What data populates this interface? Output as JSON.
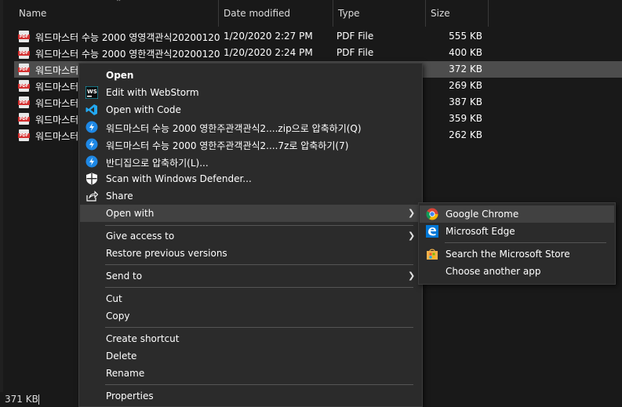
{
  "columns": {
    "name": "Name",
    "date": "Date modified",
    "type": "Type",
    "size": "Size"
  },
  "files": [
    {
      "name": "워드마스터 수능 2000 영영객관식20200120",
      "date": "1/20/2020 2:27 PM",
      "type": "PDF File",
      "size": "555 KB"
    },
    {
      "name": "워드마스터 수능 2000 영한객관식20200120",
      "date": "1/20/2020 2:24 PM",
      "type": "PDF File",
      "size": "400 KB"
    },
    {
      "name": "워드마스터",
      "date": "",
      "type": "",
      "size": "372 KB"
    },
    {
      "name": "워드마스터",
      "date": "",
      "type": "",
      "size": "269 KB"
    },
    {
      "name": "워드마스터",
      "date": "",
      "type": "",
      "size": "387 KB"
    },
    {
      "name": "워드마스터",
      "date": "",
      "type": "",
      "size": "359 KB"
    },
    {
      "name": "워드마스터",
      "date": "",
      "type": "",
      "size": "262 KB"
    }
  ],
  "context_menu": {
    "open": "Open",
    "edit_webstorm": "Edit with WebStorm",
    "open_code": "Open with Code",
    "zip": "워드마스터 수능 2000 영한주관객관식2....zip으로 압축하기(Q)",
    "sevenz": "워드마스터 수능 2000 영한주관객관식2....7z로 압축하기(7)",
    "bandizip": "반디집으로 압축하기(L)...",
    "defender": "Scan with Windows Defender...",
    "share": "Share",
    "open_with": "Open with",
    "give_access": "Give access to",
    "restore": "Restore previous versions",
    "send_to": "Send to",
    "cut": "Cut",
    "copy": "Copy",
    "create_shortcut": "Create shortcut",
    "delete": "Delete",
    "rename": "Rename",
    "properties": "Properties"
  },
  "submenu": {
    "chrome": "Google Chrome",
    "edge": "Microsoft Edge",
    "store": "Search the Microsoft Store",
    "another": "Choose another app"
  },
  "status": {
    "size": "371 KB"
  },
  "colors": {
    "background": "#191919",
    "menu": "#2b2b2b",
    "highlight": "#414141",
    "selected_row": "#4d4d4d"
  }
}
